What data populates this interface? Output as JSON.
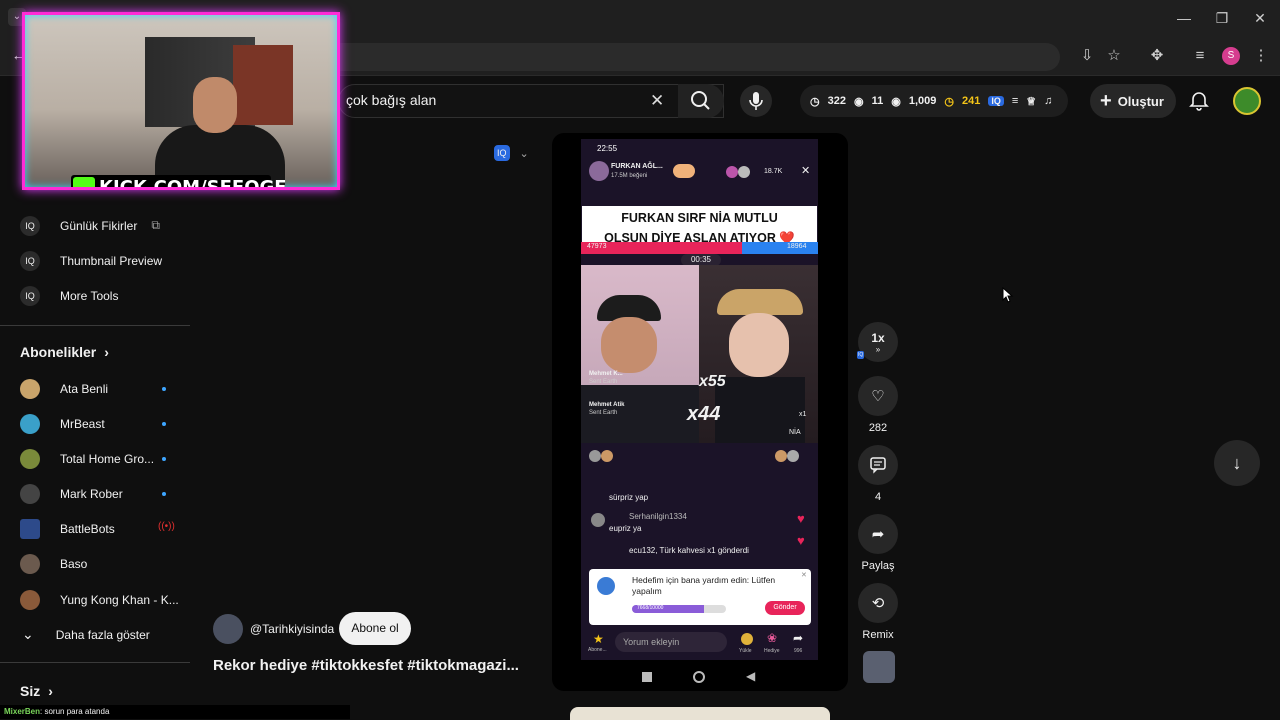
{
  "browser": {
    "win_minimize": "—",
    "win_restore": "❐",
    "win_close": "✕",
    "profile_initial": "S"
  },
  "youtube": {
    "search_value": "çok bağış alan",
    "stats": {
      "time": "322",
      "views_small": "11",
      "views": "1,009",
      "coins": "241"
    },
    "create_label": "Oluştur"
  },
  "sidebar": {
    "tools": [
      {
        "label": "Günlük Fikirler"
      },
      {
        "label": "Thumbnail Preview"
      },
      {
        "label": "More Tools"
      }
    ],
    "subs_header": "Abonelikler",
    "subs": [
      {
        "label": "Ata Benli"
      },
      {
        "label": "MrBeast"
      },
      {
        "label": "Total Home Gro..."
      },
      {
        "label": "Mark Rober"
      },
      {
        "label": "BattleBots"
      },
      {
        "label": "Baso"
      },
      {
        "label": "Yung Kong Khan - K..."
      }
    ],
    "show_more": "Daha fazla göster",
    "you_header": "Siz"
  },
  "chat_overlay": {
    "user": "MixerBen",
    "message": ": sorun para atanda"
  },
  "webcam": {
    "banner": "KICK.COM/SEFOGE"
  },
  "video": {
    "status_time": "22:55",
    "streamer_name": "FURKAN AĞL...",
    "streamer_likes": "17.5M beğeni",
    "viewer_count": "18.7K",
    "caption_line1": "FURKAN SIRF NİA MUTLU",
    "caption_line2": "OLSUN DİYE ASLAN ATIYOR ❤️",
    "battle_left": "47973",
    "battle_right": "18964",
    "battle_timer": "00:35",
    "gift1_user": "Mehmet K...",
    "gift1_sub": "Sent Earth",
    "gift1_count": "x55",
    "gift2_user": "Mehmet Atik",
    "gift2_sub": "Sent Earth",
    "gift2_count": "x44",
    "right_count": "x1",
    "nia_label": "NİA",
    "chat1": "sürpriz yap",
    "chat2_user": "Serhanilgin1334",
    "chat2_msg": "eupriz ya",
    "chat3": "ecu132, Türk kahvesi",
    "chat3_gift": "x1 gönderdi",
    "goal_text": "Hedefim için bana yardım edin: Lütfen yapalım",
    "goal_progress": "7668/10000",
    "goal_button": "Gönder",
    "comment_placeholder": "Yorum ekleyin",
    "bottom_labels": [
      "Abone...",
      "Yükle",
      "Hediye",
      "996"
    ]
  },
  "channel": {
    "handle": "@Tarihkiyisinda",
    "subscribe_label": "Abone ol"
  },
  "short_title": "Rekor hediye #tiktokkesfet #tiktokmagazi...",
  "rail": {
    "speed": "1x",
    "likes": "282",
    "comments": "4",
    "share": "Paylaş",
    "remix": "Remix"
  }
}
